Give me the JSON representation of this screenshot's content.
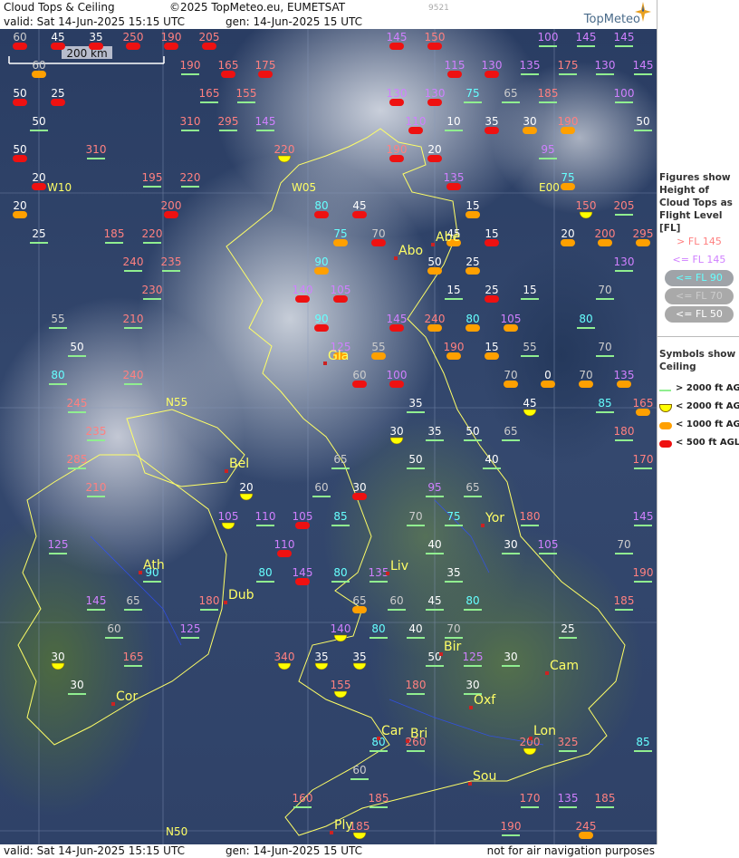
{
  "header": {
    "title": "Cloud Tops & Ceiling",
    "copyright": "©2025 TopMeteo.eu, EUMETSAT",
    "valid": "valid:  Sat  14-Jun-2025  15:15 UTC",
    "gen": "gen: 14-Jun-2025 15 UTC",
    "id": "9521",
    "brand": "TopMeteo"
  },
  "scale_bar": {
    "label": "200 km"
  },
  "legend": {
    "figures_title": "Figures show Height of Cloud Tops as Flight Level [FL]",
    "fl_items": [
      {
        "label": "> FL 145",
        "color": "#ff8080"
      },
      {
        "label": "<= FL 145",
        "color": "#d080ff"
      },
      {
        "label": "<= FL 90",
        "color": "#66ffff"
      },
      {
        "label": "<= FL 70",
        "color": "#cccccc"
      },
      {
        "label": "<= FL 50",
        "color": "#ffffff"
      }
    ],
    "symbols_title": "Symbols show Ceiling",
    "symbol_items": [
      {
        "label": "> 2000 ft AGL",
        "kind": "line",
        "color": "#90ee90"
      },
      {
        "label": "< 2000 ft AGL",
        "kind": "half",
        "color": "#ffff00"
      },
      {
        "label": "< 1000 ft AGL",
        "kind": "pill",
        "color": "#ffa000"
      },
      {
        "label": "< 500 ft AGL",
        "kind": "pill",
        "color": "#ee1111"
      }
    ]
  },
  "graticule": [
    {
      "text": "W10"
    },
    {
      "text": "W05"
    },
    {
      "text": "E00"
    },
    {
      "text": "N55"
    },
    {
      "text": "N50"
    }
  ],
  "cities": [
    {
      "name": "Abe"
    },
    {
      "name": "Abo"
    },
    {
      "name": "Gla"
    },
    {
      "name": "Bel"
    },
    {
      "name": "Yor"
    },
    {
      "name": "Ath"
    },
    {
      "name": "Dub"
    },
    {
      "name": "Liv"
    },
    {
      "name": "Bir"
    },
    {
      "name": "Cam"
    },
    {
      "name": "Cor"
    },
    {
      "name": "Oxf"
    },
    {
      "name": "Car"
    },
    {
      "name": "Bri"
    },
    {
      "name": "Lon"
    },
    {
      "name": "Sou"
    },
    {
      "name": "Ply"
    }
  ],
  "observations": [
    {
      "v": "60",
      "c": "#cccccc",
      "s": "r"
    },
    {
      "v": "45",
      "c": "#ffffff",
      "s": "r"
    },
    {
      "v": "35",
      "c": "#ffffff",
      "s": "r"
    },
    {
      "v": "250",
      "c": "#ff8080",
      "s": "r"
    },
    {
      "v": "190",
      "c": "#ff8080",
      "s": "r"
    },
    {
      "v": "205",
      "c": "#ff8080",
      "s": "r"
    },
    {
      "v": "145",
      "c": "#d080ff",
      "s": "r"
    },
    {
      "v": "150",
      "c": "#ff8080",
      "s": "r"
    },
    {
      "v": "100",
      "c": "#d080ff",
      "s": "g"
    },
    {
      "v": "145",
      "c": "#d080ff",
      "s": "g"
    },
    {
      "v": "145",
      "c": "#d080ff",
      "s": "g"
    },
    {
      "v": "60",
      "c": "#cccccc",
      "s": "o"
    },
    {
      "v": "190",
      "c": "#ff8080",
      "s": "g"
    },
    {
      "v": "165",
      "c": "#ff8080",
      "s": "r"
    },
    {
      "v": "175",
      "c": "#ff8080",
      "s": "r"
    },
    {
      "v": "115",
      "c": "#d080ff",
      "s": "r"
    },
    {
      "v": "130",
      "c": "#d080ff",
      "s": "r"
    },
    {
      "v": "135",
      "c": "#d080ff",
      "s": "g"
    },
    {
      "v": "175",
      "c": "#ff8080",
      "s": "g"
    },
    {
      "v": "130",
      "c": "#d080ff",
      "s": "g"
    },
    {
      "v": "145",
      "c": "#d080ff",
      "s": "g"
    },
    {
      "v": "50",
      "c": "#ffffff",
      "s": "r"
    },
    {
      "v": "25",
      "c": "#ffffff",
      "s": "r"
    },
    {
      "v": "165",
      "c": "#ff8080",
      "s": "g"
    },
    {
      "v": "155",
      "c": "#ff8080",
      "s": "g"
    },
    {
      "v": "130",
      "c": "#d080ff",
      "s": "r"
    },
    {
      "v": "130",
      "c": "#d080ff",
      "s": "r"
    },
    {
      "v": "75",
      "c": "#66ffff",
      "s": "g"
    },
    {
      "v": "65",
      "c": "#cccccc",
      "s": "g"
    },
    {
      "v": "185",
      "c": "#ff8080",
      "s": "g"
    },
    {
      "v": "100",
      "c": "#d080ff",
      "s": "g"
    },
    {
      "v": "50",
      "c": "#ffffff",
      "s": "g"
    },
    {
      "v": "310",
      "c": "#ff8080",
      "s": "g"
    },
    {
      "v": "295",
      "c": "#ff8080",
      "s": "g"
    },
    {
      "v": "145",
      "c": "#d080ff",
      "s": "g"
    },
    {
      "v": "110",
      "c": "#d080ff",
      "s": "r"
    },
    {
      "v": "10",
      "c": "#ffffff",
      "s": "g"
    },
    {
      "v": "35",
      "c": "#ffffff",
      "s": "r"
    },
    {
      "v": "30",
      "c": "#ffffff",
      "s": "o"
    },
    {
      "v": "190",
      "c": "#ff8080",
      "s": "o"
    },
    {
      "v": "50",
      "c": "#ffffff",
      "s": "g"
    },
    {
      "v": "50",
      "c": "#ffffff",
      "s": "r"
    },
    {
      "v": "310",
      "c": "#ff8080",
      "s": "g"
    },
    {
      "v": "220",
      "c": "#ff8080",
      "s": "y"
    },
    {
      "v": "190",
      "c": "#ff8080",
      "s": "r"
    },
    {
      "v": "20",
      "c": "#ffffff",
      "s": "r"
    },
    {
      "v": "95",
      "c": "#d080ff",
      "s": "g"
    },
    {
      "v": "20",
      "c": "#ffffff",
      "s": "r"
    },
    {
      "v": "195",
      "c": "#ff8080",
      "s": "g"
    },
    {
      "v": "220",
      "c": "#ff8080",
      "s": "g"
    },
    {
      "v": "135",
      "c": "#d080ff",
      "s": "r"
    },
    {
      "v": "75",
      "c": "#66ffff",
      "s": "o"
    },
    {
      "v": "20",
      "c": "#ffffff",
      "s": "o"
    },
    {
      "v": "200",
      "c": "#ff8080",
      "s": "r"
    },
    {
      "v": "80",
      "c": "#66ffff",
      "s": "r"
    },
    {
      "v": "45",
      "c": "#ffffff",
      "s": "r"
    },
    {
      "v": "15",
      "c": "#ffffff",
      "s": "o"
    },
    {
      "v": "150",
      "c": "#ff8080",
      "s": "y"
    },
    {
      "v": "205",
      "c": "#ff8080",
      "s": "g"
    },
    {
      "v": "25",
      "c": "#ffffff",
      "s": "g"
    },
    {
      "v": "185",
      "c": "#ff8080",
      "s": "g"
    },
    {
      "v": "220",
      "c": "#ff8080",
      "s": "g"
    },
    {
      "v": "75",
      "c": "#66ffff",
      "s": "o"
    },
    {
      "v": "70",
      "c": "#cccccc",
      "s": "r"
    },
    {
      "v": "45",
      "c": "#ffffff",
      "s": "o"
    },
    {
      "v": "15",
      "c": "#ffffff",
      "s": "r"
    },
    {
      "v": "20",
      "c": "#ffffff",
      "s": "o"
    },
    {
      "v": "200",
      "c": "#ff8080",
      "s": "o"
    },
    {
      "v": "295",
      "c": "#ff8080",
      "s": "o"
    },
    {
      "v": "240",
      "c": "#ff8080",
      "s": "g"
    },
    {
      "v": "235",
      "c": "#ff8080",
      "s": "g"
    },
    {
      "v": "90",
      "c": "#66ffff",
      "s": "o"
    },
    {
      "v": "50",
      "c": "#ffffff",
      "s": "o"
    },
    {
      "v": "25",
      "c": "#ffffff",
      "s": "o"
    },
    {
      "v": "130",
      "c": "#d080ff",
      "s": "g"
    },
    {
      "v": "230",
      "c": "#ff8080",
      "s": "g"
    },
    {
      "v": "140",
      "c": "#d080ff",
      "s": "r"
    },
    {
      "v": "105",
      "c": "#d080ff",
      "s": "r"
    },
    {
      "v": "15",
      "c": "#ffffff",
      "s": "g"
    },
    {
      "v": "25",
      "c": "#ffffff",
      "s": "r"
    },
    {
      "v": "15",
      "c": "#ffffff",
      "s": "g"
    },
    {
      "v": "70",
      "c": "#cccccc",
      "s": "g"
    },
    {
      "v": "55",
      "c": "#cccccc",
      "s": "g"
    },
    {
      "v": "210",
      "c": "#ff8080",
      "s": "g"
    },
    {
      "v": "90",
      "c": "#66ffff",
      "s": "r"
    },
    {
      "v": "145",
      "c": "#d080ff",
      "s": "r"
    },
    {
      "v": "240",
      "c": "#ff8080",
      "s": "o"
    },
    {
      "v": "80",
      "c": "#66ffff",
      "s": "o"
    },
    {
      "v": "105",
      "c": "#d080ff",
      "s": "o"
    },
    {
      "v": "80",
      "c": "#66ffff",
      "s": "g"
    },
    {
      "v": "50",
      "c": "#ffffff",
      "s": "g"
    },
    {
      "v": "125",
      "c": "#d080ff",
      "s": "o"
    },
    {
      "v": "55",
      "c": "#cccccc",
      "s": "o"
    },
    {
      "v": "190",
      "c": "#ff8080",
      "s": "o"
    },
    {
      "v": "15",
      "c": "#ffffff",
      "s": "o"
    },
    {
      "v": "55",
      "c": "#cccccc",
      "s": "g"
    },
    {
      "v": "70",
      "c": "#cccccc",
      "s": "g"
    },
    {
      "v": "80",
      "c": "#66ffff",
      "s": "g"
    },
    {
      "v": "240",
      "c": "#ff8080",
      "s": "g"
    },
    {
      "v": "60",
      "c": "#cccccc",
      "s": "r"
    },
    {
      "v": "100",
      "c": "#d080ff",
      "s": "r"
    },
    {
      "v": "70",
      "c": "#cccccc",
      "s": "o"
    },
    {
      "v": "0",
      "c": "#ffffff",
      "s": "o"
    },
    {
      "v": "70",
      "c": "#cccccc",
      "s": "o"
    },
    {
      "v": "135",
      "c": "#d080ff",
      "s": "o"
    },
    {
      "v": "245",
      "c": "#ff8080",
      "s": "g"
    },
    {
      "v": "35",
      "c": "#ffffff",
      "s": "g"
    },
    {
      "v": "45",
      "c": "#ffffff",
      "s": "y"
    },
    {
      "v": "85",
      "c": "#66ffff",
      "s": "g"
    },
    {
      "v": "165",
      "c": "#ff8080",
      "s": "o"
    },
    {
      "v": "235",
      "c": "#ff8080",
      "s": "g"
    },
    {
      "v": "30",
      "c": "#ffffff",
      "s": "y"
    },
    {
      "v": "35",
      "c": "#ffffff",
      "s": "g"
    },
    {
      "v": "50",
      "c": "#ffffff",
      "s": "g"
    },
    {
      "v": "65",
      "c": "#cccccc",
      "s": "g"
    },
    {
      "v": "180",
      "c": "#ff8080",
      "s": "g"
    },
    {
      "v": "285",
      "c": "#ff8080",
      "s": "g"
    },
    {
      "v": "65",
      "c": "#cccccc",
      "s": "g"
    },
    {
      "v": "50",
      "c": "#ffffff",
      "s": "g"
    },
    {
      "v": "40",
      "c": "#ffffff",
      "s": "g"
    },
    {
      "v": "170",
      "c": "#ff8080",
      "s": "g"
    },
    {
      "v": "210",
      "c": "#ff8080",
      "s": "g"
    },
    {
      "v": "20",
      "c": "#ffffff",
      "s": "y"
    },
    {
      "v": "60",
      "c": "#cccccc",
      "s": "g"
    },
    {
      "v": "30",
      "c": "#ffffff",
      "s": "r"
    },
    {
      "v": "95",
      "c": "#d080ff",
      "s": "g"
    },
    {
      "v": "65",
      "c": "#cccccc",
      "s": "g"
    },
    {
      "v": "105",
      "c": "#d080ff",
      "s": "y"
    },
    {
      "v": "110",
      "c": "#d080ff",
      "s": "g"
    },
    {
      "v": "105",
      "c": "#d080ff",
      "s": "r"
    },
    {
      "v": "85",
      "c": "#66ffff",
      "s": "g"
    },
    {
      "v": "70",
      "c": "#cccccc",
      "s": "g"
    },
    {
      "v": "75",
      "c": "#66ffff",
      "s": "g"
    },
    {
      "v": "180",
      "c": "#ff8080",
      "s": "g"
    },
    {
      "v": "145",
      "c": "#d080ff",
      "s": "g"
    },
    {
      "v": "125",
      "c": "#d080ff",
      "s": "g"
    },
    {
      "v": "110",
      "c": "#d080ff",
      "s": "r"
    },
    {
      "v": "40",
      "c": "#ffffff",
      "s": "g"
    },
    {
      "v": "30",
      "c": "#ffffff",
      "s": "g"
    },
    {
      "v": "105",
      "c": "#d080ff",
      "s": "g"
    },
    {
      "v": "70",
      "c": "#cccccc",
      "s": "g"
    },
    {
      "v": "90",
      "c": "#66ffff",
      "s": "g"
    },
    {
      "v": "80",
      "c": "#66ffff",
      "s": "g"
    },
    {
      "v": "145",
      "c": "#d080ff",
      "s": "r"
    },
    {
      "v": "80",
      "c": "#66ffff",
      "s": "g"
    },
    {
      "v": "135",
      "c": "#d080ff",
      "s": "g"
    },
    {
      "v": "35",
      "c": "#ffffff",
      "s": "g"
    },
    {
      "v": "190",
      "c": "#ff8080",
      "s": "g"
    },
    {
      "v": "145",
      "c": "#d080ff",
      "s": "g"
    },
    {
      "v": "65",
      "c": "#cccccc",
      "s": "g"
    },
    {
      "v": "180",
      "c": "#ff8080",
      "s": "g"
    },
    {
      "v": "65",
      "c": "#cccccc",
      "s": "o"
    },
    {
      "v": "60",
      "c": "#cccccc",
      "s": "g"
    },
    {
      "v": "45",
      "c": "#ffffff",
      "s": "g"
    },
    {
      "v": "80",
      "c": "#66ffff",
      "s": "g"
    },
    {
      "v": "185",
      "c": "#ff8080",
      "s": "g"
    },
    {
      "v": "60",
      "c": "#cccccc",
      "s": "g"
    },
    {
      "v": "125",
      "c": "#d080ff",
      "s": "g"
    },
    {
      "v": "140",
      "c": "#d080ff",
      "s": "y"
    },
    {
      "v": "80",
      "c": "#66ffff",
      "s": "g"
    },
    {
      "v": "40",
      "c": "#ffffff",
      "s": "g"
    },
    {
      "v": "70",
      "c": "#cccccc",
      "s": "g"
    },
    {
      "v": "25",
      "c": "#ffffff",
      "s": "g"
    },
    {
      "v": "30",
      "c": "#ffffff",
      "s": "y"
    },
    {
      "v": "165",
      "c": "#ff8080",
      "s": "g"
    },
    {
      "v": "340",
      "c": "#ff8080",
      "s": "y"
    },
    {
      "v": "35",
      "c": "#ffffff",
      "s": "y"
    },
    {
      "v": "35",
      "c": "#ffffff",
      "s": "y"
    },
    {
      "v": "50",
      "c": "#ffffff",
      "s": "g"
    },
    {
      "v": "125",
      "c": "#d080ff",
      "s": "g"
    },
    {
      "v": "30",
      "c": "#ffffff",
      "s": "g"
    },
    {
      "v": "30",
      "c": "#ffffff",
      "s": "g"
    },
    {
      "v": "155",
      "c": "#ff8080",
      "s": "y"
    },
    {
      "v": "180",
      "c": "#ff8080",
      "s": "g"
    },
    {
      "v": "30",
      "c": "#ffffff",
      "s": "g"
    },
    {
      "v": "80",
      "c": "#66ffff",
      "s": "g"
    },
    {
      "v": "260",
      "c": "#ff8080",
      "s": "g"
    },
    {
      "v": "200",
      "c": "#ff8080",
      "s": "y"
    },
    {
      "v": "325",
      "c": "#ff8080",
      "s": "g"
    },
    {
      "v": "85",
      "c": "#66ffff",
      "s": "g"
    },
    {
      "v": "60",
      "c": "#cccccc",
      "s": "g"
    },
    {
      "v": "160",
      "c": "#ff8080",
      "s": "g"
    },
    {
      "v": "185",
      "c": "#ff8080",
      "s": "g"
    },
    {
      "v": "170",
      "c": "#ff8080",
      "s": "g"
    },
    {
      "v": "135",
      "c": "#d080ff",
      "s": "g"
    },
    {
      "v": "185",
      "c": "#ff8080",
      "s": "g"
    },
    {
      "v": "185",
      "c": "#ff8080",
      "s": "y"
    },
    {
      "v": "190",
      "c": "#ff8080",
      "s": "g"
    },
    {
      "v": "245",
      "c": "#ff8080",
      "s": "o"
    }
  ],
  "footer": {
    "valid": "valid:  Sat  14-Jun-2025  15:15 UTC",
    "gen": "gen: 14-Jun-2025 15 UTC",
    "note": "not for air navigation purposes"
  }
}
